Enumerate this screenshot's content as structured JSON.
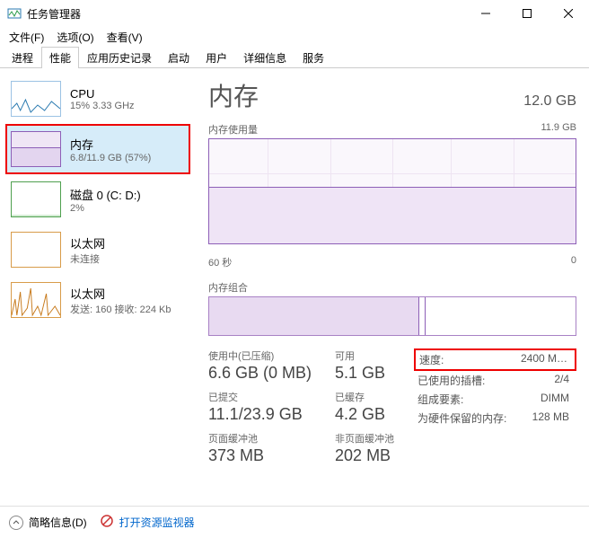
{
  "window": {
    "title": "任务管理器"
  },
  "menu": {
    "file": "文件(F)",
    "options": "选项(O)",
    "view": "查看(V)"
  },
  "tabs": [
    "进程",
    "性能",
    "应用历史记录",
    "启动",
    "用户",
    "详细信息",
    "服务"
  ],
  "active_tab_index": 1,
  "sidebar": {
    "items": [
      {
        "title": "CPU",
        "sub": "15% 3.33 GHz"
      },
      {
        "title": "内存",
        "sub": "6.8/11.9 GB (57%)"
      },
      {
        "title": "磁盘 0 (C: D:)",
        "sub": "2%"
      },
      {
        "title": "以太网",
        "sub": "未连接"
      },
      {
        "title": "以太网",
        "sub": "发送: 160 接收: 224 Kb"
      }
    ],
    "selected_index": 1
  },
  "main": {
    "title": "内存",
    "total": "12.0 GB",
    "usage_label": "内存使用量",
    "usage_max": "11.9 GB",
    "x_label": "60 秒",
    "x_zero": "0",
    "composition_label": "内存组合",
    "stats_left": [
      {
        "label": "使用中(已压缩)",
        "value": "6.6 GB (0 MB)"
      },
      {
        "label": "可用",
        "value": "5.1 GB"
      },
      {
        "label": "已提交",
        "value": "11.1/23.9 GB"
      },
      {
        "label": "已缓存",
        "value": "4.2 GB"
      },
      {
        "label": "页面缓冲池",
        "value": "373 MB"
      },
      {
        "label": "非页面缓冲池",
        "value": "202 MB"
      }
    ],
    "stats_right": [
      {
        "label": "速度:",
        "value": "2400 M…"
      },
      {
        "label": "已使用的插槽:",
        "value": "2/4"
      },
      {
        "label": "组成要素:",
        "value": "DIMM"
      },
      {
        "label": "为硬件保留的内存:",
        "value": "128 MB"
      }
    ]
  },
  "footer": {
    "less": "简略信息(D)",
    "resmon": "打开资源监视器"
  }
}
